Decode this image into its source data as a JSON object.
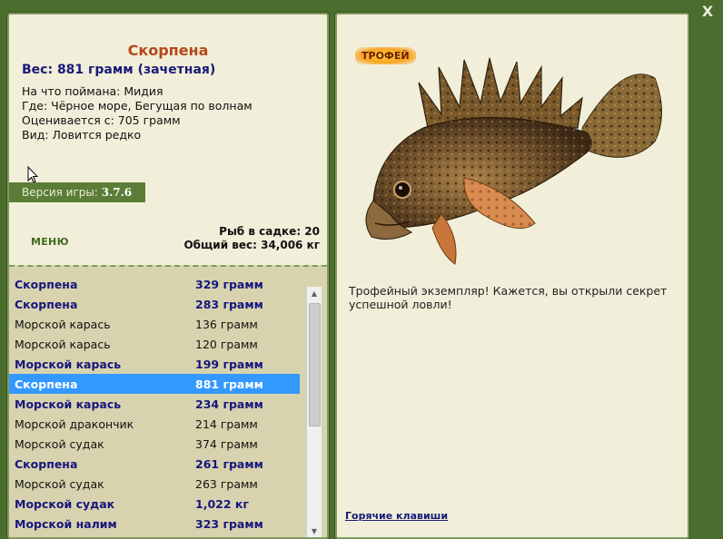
{
  "close_label": "X",
  "fish": {
    "title": "Скорпена",
    "weight": "Вес: 881 грамм (зачетная)",
    "caught_on": "На что поймана: Мидия",
    "location": "Где: Чёрное море, Бегущая по волнам",
    "valued_from": "Оценивается с: 705 грамм",
    "species": "Вид: Ловится редко"
  },
  "version": {
    "label": "Версия игры:",
    "value": "3.7.6"
  },
  "menu_label": "МЕНЮ",
  "stats": {
    "fish_count": "Рыб в садке: 20",
    "total_weight": "Общий вес: 34,006 кг"
  },
  "catch_list": [
    {
      "name": "Скорпена",
      "weight": "329 грамм",
      "bold": true
    },
    {
      "name": "Скорпена",
      "weight": "283 грамм",
      "bold": true
    },
    {
      "name": "Морской карась",
      "weight": "136 грамм",
      "bold": false
    },
    {
      "name": "Морской карась",
      "weight": "120 грамм",
      "bold": false
    },
    {
      "name": "Морской карась",
      "weight": "199 грамм",
      "bold": true
    },
    {
      "name": "Скорпена",
      "weight": "881 грамм",
      "bold": true,
      "selected": true
    },
    {
      "name": "Морской карась",
      "weight": "234 грамм",
      "bold": true
    },
    {
      "name": "Морской дракончик",
      "weight": "214 грамм",
      "bold": false
    },
    {
      "name": "Морской судак",
      "weight": "374 грамм",
      "bold": false
    },
    {
      "name": "Скорпена",
      "weight": "261 грамм",
      "bold": true
    },
    {
      "name": "Морской судак",
      "weight": "263 грамм",
      "bold": false
    },
    {
      "name": "Морской судак",
      "weight": "1,022 кг",
      "bold": true
    },
    {
      "name": "Морской налим",
      "weight": "323 грамм",
      "bold": true
    }
  ],
  "trophy_label": "ТРОФЕЙ",
  "message": "Трофейный экземпляр! Кажется, вы открыли секрет успешной ловли!",
  "hotkeys_label": "Горячие клавиши",
  "colors": {
    "bg": "#4b6d2d",
    "panel": "#f1efd9",
    "list_bg": "#d8d3ae",
    "selected": "#3399ff",
    "title": "#b5471a",
    "bold_text": "#16167e"
  }
}
